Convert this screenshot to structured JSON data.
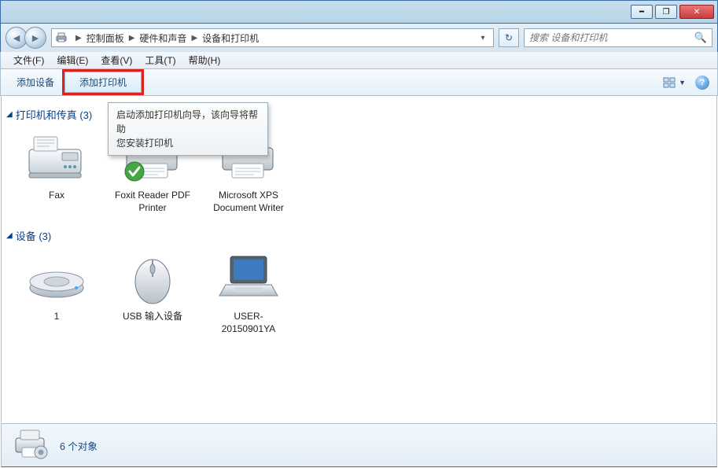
{
  "window": {
    "breadcrumbs": [
      "控制面板",
      "硬件和声音",
      "设备和打印机"
    ],
    "search_placeholder": "搜索 设备和打印机"
  },
  "menubar": {
    "file": "文件(F)",
    "edit": "编辑(E)",
    "view": "查看(V)",
    "tools": "工具(T)",
    "help": "帮助(H)"
  },
  "cmdbar": {
    "add_device": "添加设备",
    "add_printer": "添加打印机"
  },
  "tooltip": {
    "line1": "启动添加打印机向导，该向导将帮助",
    "line2": "您安装打印机"
  },
  "groups": {
    "printers": {
      "title": "打印机和传真 (3)"
    },
    "devices": {
      "title": "设备 (3)"
    }
  },
  "items": {
    "printers": [
      {
        "label": "Fax"
      },
      {
        "label": "Foxit Reader PDF Printer"
      },
      {
        "label": "Microsoft XPS Document Writer"
      }
    ],
    "devices": [
      {
        "label": "1"
      },
      {
        "label": "USB 输入设备"
      },
      {
        "label": "USER-20150901YA"
      }
    ]
  },
  "statusbar": {
    "text": "6 个对象"
  }
}
